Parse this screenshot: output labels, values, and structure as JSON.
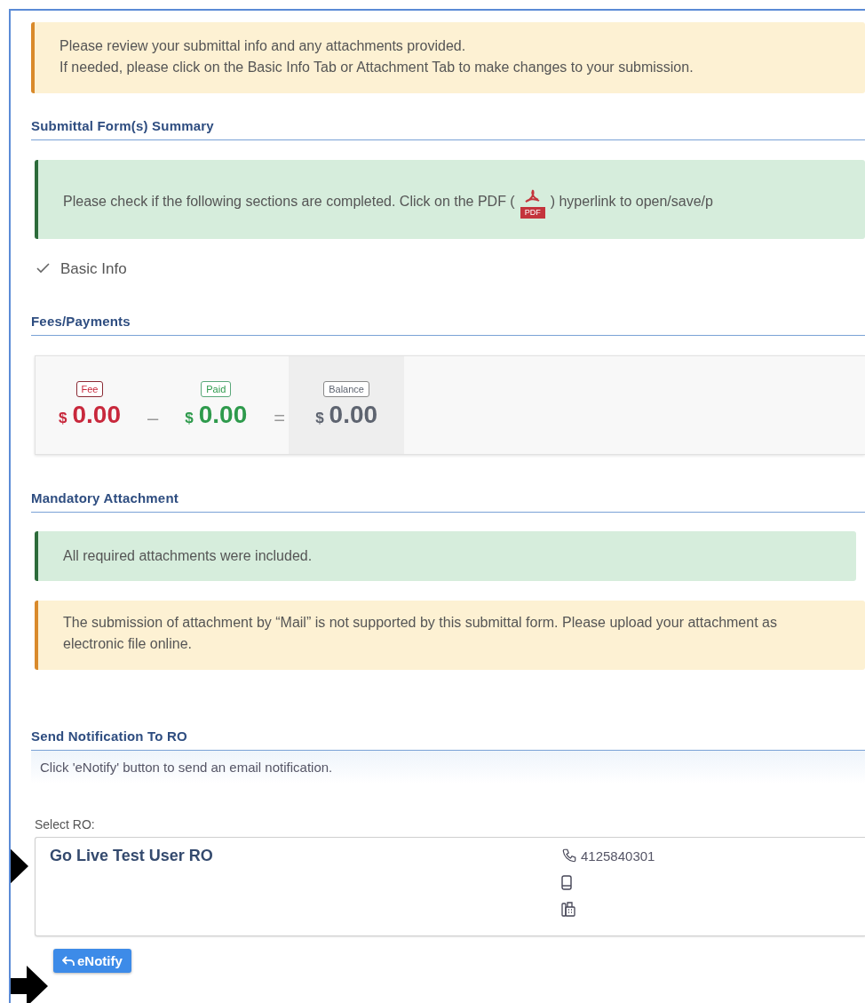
{
  "review_notice": {
    "kind": "warning",
    "lines": [
      "Please review your submittal info and any attachments provided.",
      "If needed, please click on the Basic Info Tab or Attachment Tab to make changes to your submission."
    ]
  },
  "summary": {
    "title": "Submittal Form(s) Summary",
    "notice": {
      "kind": "success",
      "text_before": "Please check if the following sections are completed. Click on the PDF (",
      "icon_label": "PDF",
      "text_after": ") hyperlink to open/save/p"
    },
    "items": [
      {
        "label": "Basic Info",
        "completed": true
      }
    ]
  },
  "fees": {
    "title": "Fees/Payments",
    "items": [
      {
        "kind": "fee",
        "label": "Fee",
        "currency": "$",
        "amount": "0.00",
        "operator": "–"
      },
      {
        "kind": "paid",
        "label": "Paid",
        "currency": "$",
        "amount": "0.00",
        "operator": "="
      },
      {
        "kind": "balance",
        "label": "Balance",
        "currency": "$",
        "amount": "0.00"
      }
    ]
  },
  "attachments": {
    "title": "Mandatory Attachment",
    "notices": [
      {
        "kind": "success",
        "text": "All required attachments were included."
      },
      {
        "kind": "warning",
        "text": "The submission of attachment by “Mail” is not supported by this submittal form. Please upload your attachment as electronic file online."
      }
    ]
  },
  "notification": {
    "title": "Send Notification To RO",
    "hint": "Click 'eNotify' button to send an email notification.",
    "select_label": "Select RO:",
    "ro": {
      "name": "Go Live Test User RO",
      "phone": "4125840301"
    },
    "button": "eNotify"
  }
}
